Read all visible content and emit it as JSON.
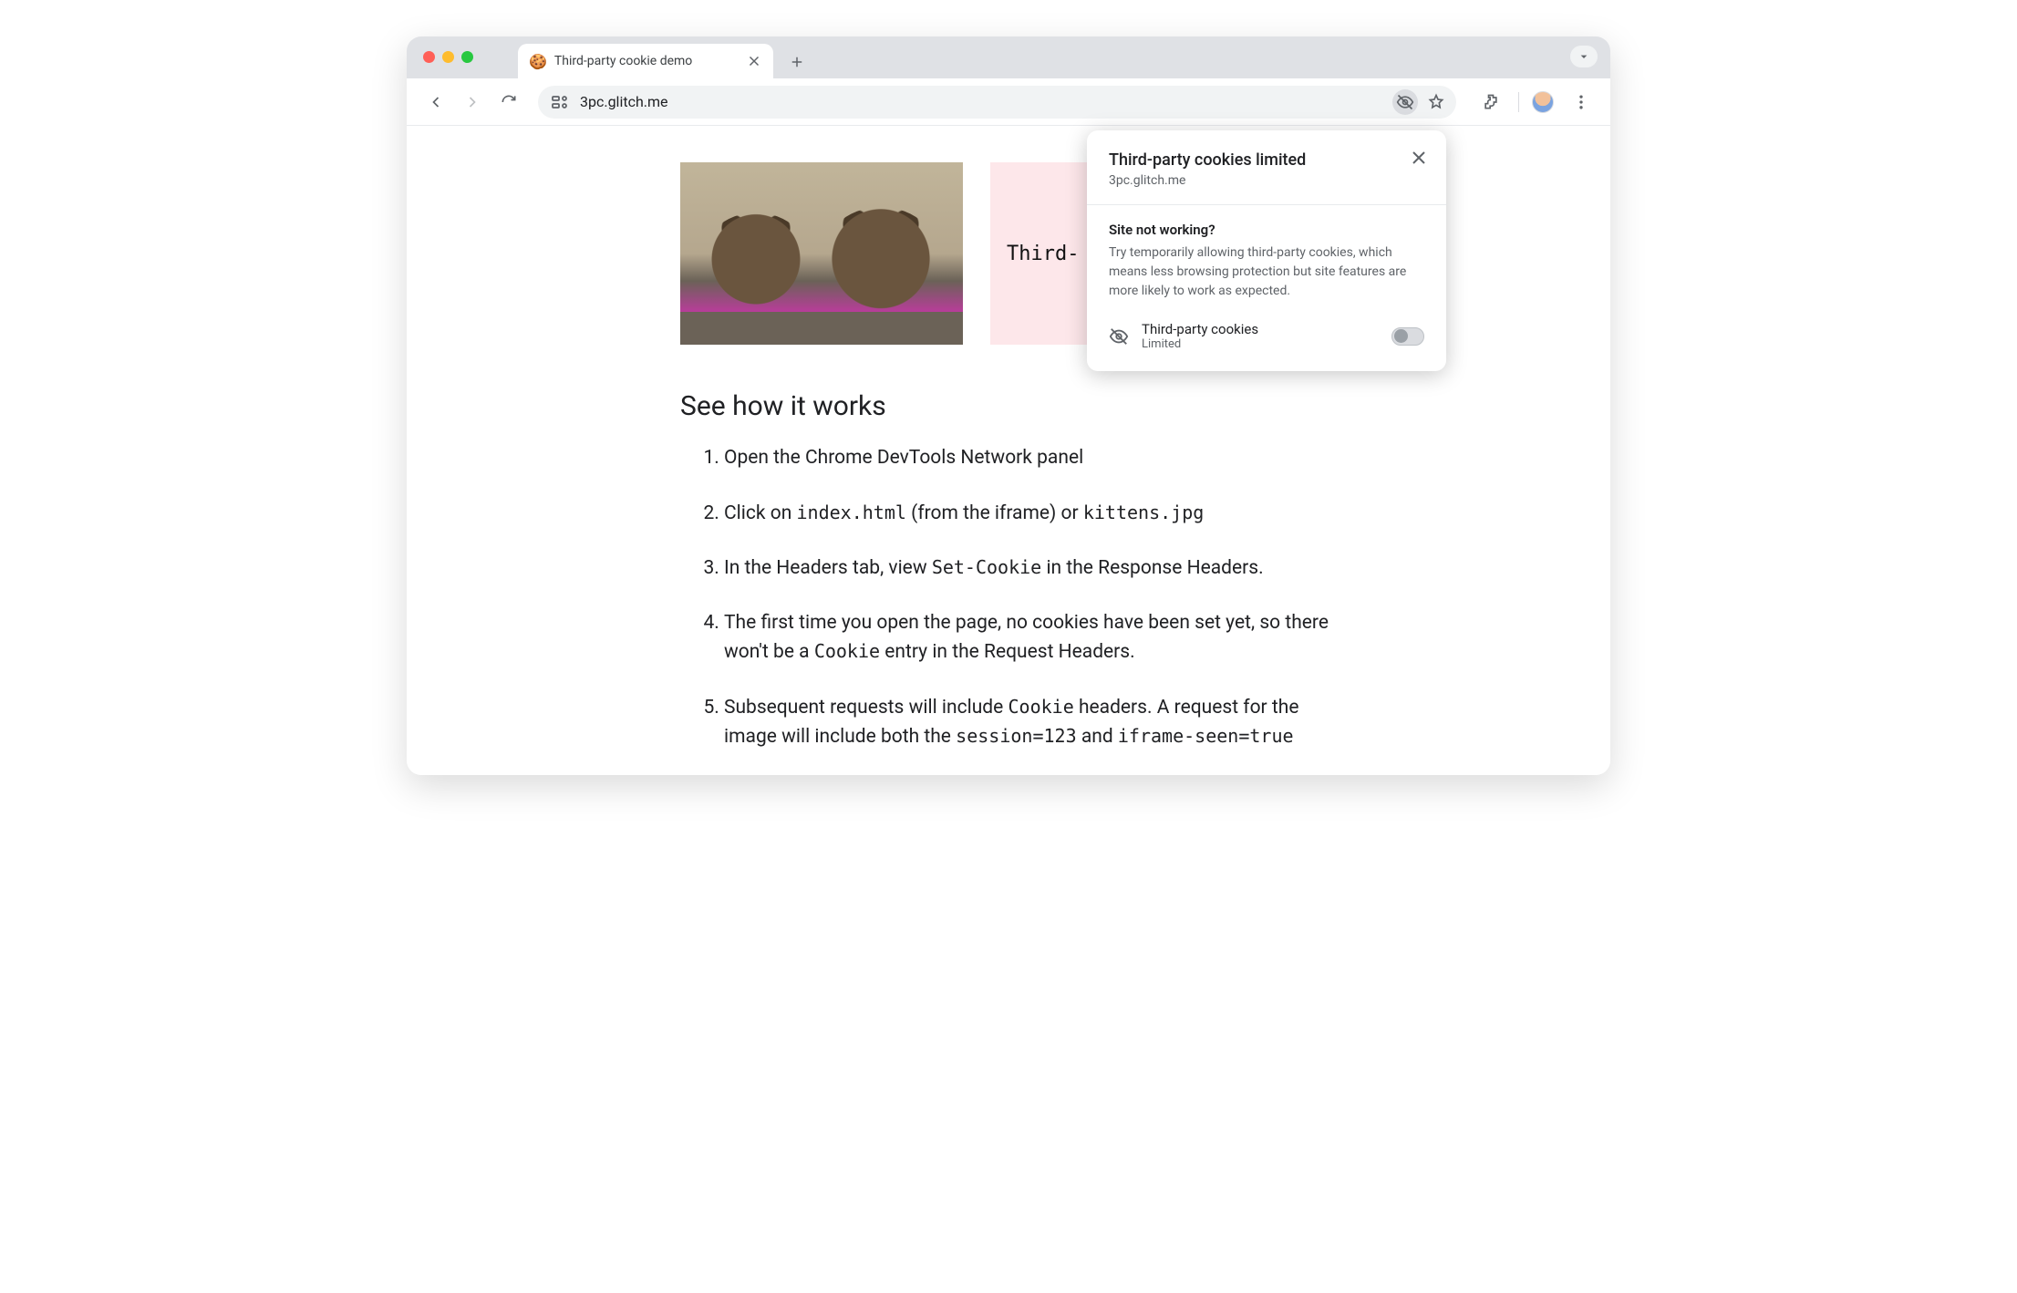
{
  "tab": {
    "title": "Third-party cookie demo",
    "favicon": "🍪"
  },
  "toolbar": {
    "url": "3pc.glitch.me"
  },
  "popover": {
    "title": "Third-party cookies limited",
    "site": "3pc.glitch.me",
    "question": "Site not working?",
    "description": "Try temporarily allowing third-party cookies, which means less browsing protection but site features are more likely to work as expected.",
    "toggle_label": "Third-party cookies",
    "toggle_state": "Limited"
  },
  "page": {
    "iframe_text": "Third-",
    "section_heading": "See how it works",
    "steps": {
      "s1": "Open the Chrome DevTools Network panel",
      "s2a": "Click on ",
      "s2_code1": "index.html",
      "s2b": " (from the iframe) or ",
      "s2_code2": "kittens.jpg",
      "s3a": "In the Headers tab, view ",
      "s3_code1": "Set-Cookie",
      "s3b": " in the Response Headers.",
      "s4a": "The first time you open the page, no cookies have been set yet, so there won't be a ",
      "s4_code1": "Cookie",
      "s4b": " entry in the Request Headers.",
      "s5a": "Subsequent requests will include ",
      "s5_code1": "Cookie",
      "s5b": " headers. A request for the image will include both the ",
      "s5_code2": "session=123",
      "s5c": " and ",
      "s5_code3": "iframe-seen=true"
    }
  }
}
